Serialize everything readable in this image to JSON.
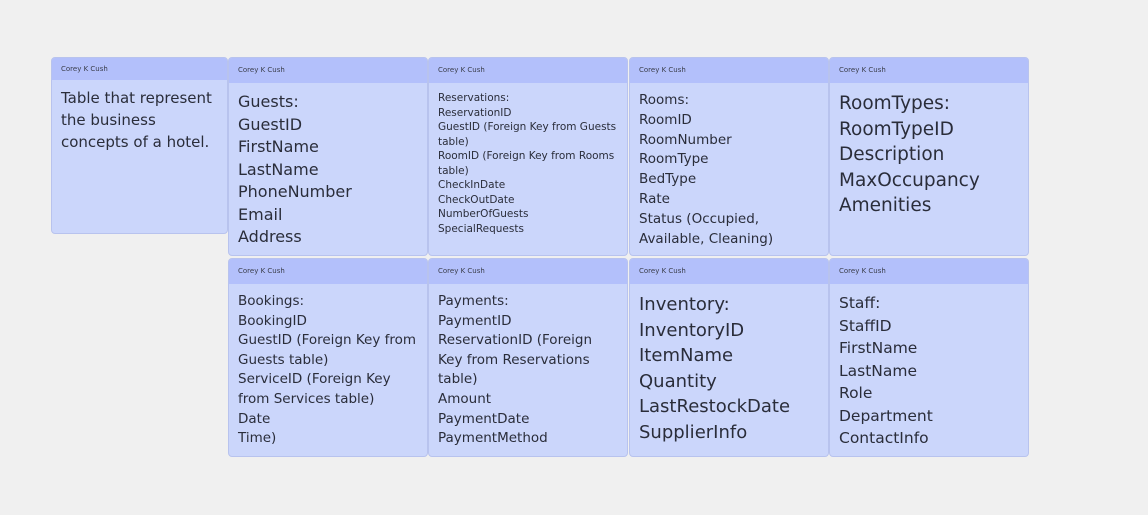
{
  "author": "Corey K Cush",
  "intro_note": "Table that represent the business concepts of a hotel.",
  "cards": [
    {
      "lines": [
        "Guests:",
        "GuestID",
        "FirstName",
        "LastName",
        "PhoneNumber",
        "Email",
        "Address"
      ]
    },
    {
      "lines": [
        "Reservations:",
        "ReservationID",
        "GuestID (Foreign Key from Guests table)",
        "RoomID (Foreign Key from Rooms table)",
        "CheckInDate",
        "CheckOutDate",
        "NumberOfGuests",
        "SpecialRequests"
      ]
    },
    {
      "lines": [
        "Rooms:",
        "RoomID",
        "RoomNumber",
        "RoomType",
        "BedType",
        "Rate",
        "Status (Occupied, Available, Cleaning)"
      ]
    },
    {
      "lines": [
        "RoomTypes:",
        "RoomTypeID",
        "Description",
        "MaxOccupancy",
        "Amenities"
      ]
    },
    {
      "lines": [
        "Bookings:",
        "BookingID",
        "GuestID (Foreign Key from Guests table)",
        "ServiceID (Foreign Key from Services table)",
        "Date",
        "Time)"
      ]
    },
    {
      "lines": [
        "Payments:",
        "PaymentID",
        "ReservationID (Foreign Key from Reservations table)",
        "Amount",
        "PaymentDate",
        "PaymentMethod"
      ]
    },
    {
      "lines": [
        "Inventory:",
        "InventoryID",
        "ItemName",
        "Quantity",
        "LastRestockDate",
        "SupplierInfo"
      ]
    },
    {
      "lines": [
        "Staff:",
        "StaffID",
        "FirstName",
        "LastName",
        "Role",
        "Department",
        "ContactInfo"
      ]
    }
  ]
}
